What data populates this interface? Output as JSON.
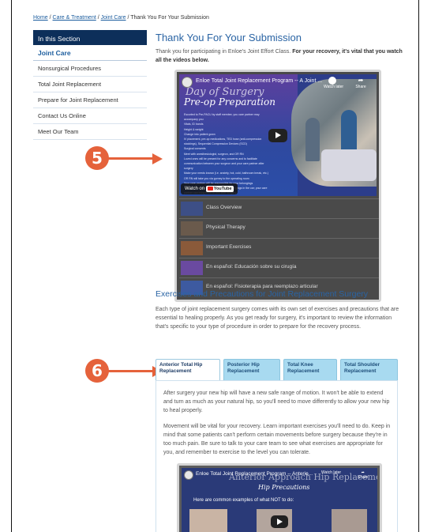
{
  "breadcrumb": {
    "home": "Home",
    "care": "Care & Treatment",
    "joint": "Joint Care",
    "current": "Thank You For Your Submission",
    "sep": " / "
  },
  "sidebar": {
    "heading": "In this Section",
    "items": [
      {
        "label": "Joint Care"
      },
      {
        "label": "Nonsurgical Procedures"
      },
      {
        "label": "Total Joint Replacement"
      },
      {
        "label": "Prepare for Joint Replacement"
      },
      {
        "label": "Contact Us Online"
      },
      {
        "label": "Meet Our Team"
      }
    ]
  },
  "main": {
    "title": "Thank You For Your Submission",
    "intro_plain": "Thank you for participating in Enloe's Joint Effort Class. ",
    "intro_bold": "For your recovery, it's vital that you watch all the videos below."
  },
  "playlist": {
    "video_title": "Enloe Total Joint Replacement Program -- A Joint ...",
    "video_big1": "Day of Surgery",
    "video_big2": "Pre-op Preparation",
    "video_lines": [
      "Escorted to Pre-PACU by staff member, you care partner may",
      "accompany you",
      "Vitals, ID bands",
      "Height & weight",
      "Change into patient gown",
      "IV placement, pre-op medications, TED hose (anti-compression",
      "stockings), Sequential Compression Devices (SCD)",
      "Surgical consents",
      "Meet with anesthesiologist, surgeon, and OR RN",
      "Loved ones will be present for any concerns and to facilitate",
      "communication between your surgeon and your care partner after",
      "surgery",
      "Make your needs known (i.e. anxiety, hot, cold, bathroom break, etc.)",
      "OR RN will take you via gurney to the operating room",
      "Your care partner will be responsible for your belongings",
      "-- please leave valuables at home -- belongings in the car; your care",
      "partner can bring them to you after surgery"
    ],
    "watch_later": "Watch later",
    "share": "Share",
    "watch_on": "Watch on",
    "youtube": "YouTube",
    "items": [
      {
        "title": "Class Overview",
        "color": "#3d4f86"
      },
      {
        "title": "Physical Therapy",
        "color": "#6a5a4c"
      },
      {
        "title": "Important Exercises",
        "color": "#8a5a3a"
      },
      {
        "title": "En español: Educación sobre su cirugía",
        "color": "#6a4aa0"
      },
      {
        "title": "En español: Fisioterapia para reemplazo articular",
        "color": "#3d5aa0"
      }
    ]
  },
  "callouts": {
    "five": "5",
    "six": "6"
  },
  "exercises": {
    "title": "Exercises and Precautions for Joint Replacement Surgery",
    "text": "Each type of joint replacement surgery comes with its own set of exercises and precautions that are essential to healing properly. As you get ready for surgery, it's important to review the information that's specific to your type of procedure in order to prepare for the recovery process.",
    "tabs": [
      {
        "label": "Anterior Total Hip Replacement",
        "active": true
      },
      {
        "label": "Posterior Hip Replacement",
        "active": false
      },
      {
        "label": "Total Knee Replacement",
        "active": false
      },
      {
        "label": "Total Shoulder Replacement",
        "active": false
      }
    ],
    "panel_p1": "After surgery your new hip will have a new safe range of motion. It won't be able to extend and turn as much as your natural hip, so you'll need to move differently to allow your new hip to heal properly.",
    "panel_p2": "Movement will be vital for your recovery. Learn important exercises you'll need to do. Keep in mind that some patients can't perform certain movements before surgery because they're in too much pain. Be sure to talk to your care team to see what exercises are appropriate for you, and remember to exercise to the level you can tolerate."
  },
  "video2": {
    "title": "Enloe Total Joint Replacement Program -- Anterio...",
    "bg1": "Anterior Approach Hip Replacement",
    "bg2": "Hip Precautions",
    "note": "Here are common examples of what NOT to do:",
    "watch_later": "Watch later",
    "share": "Share"
  },
  "colors": {
    "brand": "#0d2f5a",
    "link": "#2a64a4",
    "callout": "#e5623b",
    "tab": "#a8daf0"
  }
}
